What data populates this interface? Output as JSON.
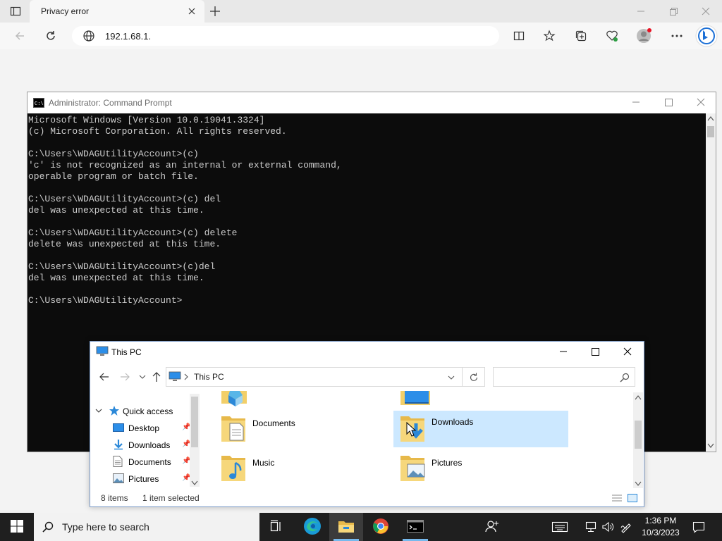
{
  "browser": {
    "tab_title": "Privacy error",
    "url": "192.1.68.1."
  },
  "cmd": {
    "title": "Administrator: Command Prompt",
    "lines": [
      "Microsoft Windows [Version 10.0.19041.3324]",
      "(c) Microsoft Corporation. All rights reserved.",
      "",
      "C:\\Users\\WDAGUtilityAccount>(c)",
      "'c' is not recognized as an internal or external command,",
      "operable program or batch file.",
      "",
      "C:\\Users\\WDAGUtilityAccount>(c) del",
      "del was unexpected at this time.",
      "",
      "C:\\Users\\WDAGUtilityAccount>(c) delete",
      "delete was unexpected at this time.",
      "",
      "C:\\Users\\WDAGUtilityAccount>(c)del",
      "del was unexpected at this time.",
      "",
      "C:\\Users\\WDAGUtilityAccount>"
    ]
  },
  "explorer": {
    "title": "This PC",
    "address": "This PC",
    "nav": {
      "quick_access": "Quick access",
      "items": [
        "Desktop",
        "Downloads",
        "Documents",
        "Pictures"
      ]
    },
    "folders": {
      "documents": "Documents",
      "downloads": "Downloads",
      "music": "Music",
      "pictures": "Pictures"
    },
    "status": {
      "items": "8 items",
      "selected": "1 item selected"
    }
  },
  "taskbar": {
    "search_placeholder": "Type here to search",
    "time": "1:36 PM",
    "date": "10/3/2023"
  },
  "colors": {
    "selection": "#cce8ff",
    "accent": "#0078d4",
    "console_bg": "#0c0c0c",
    "console_fg": "#cccccc"
  }
}
